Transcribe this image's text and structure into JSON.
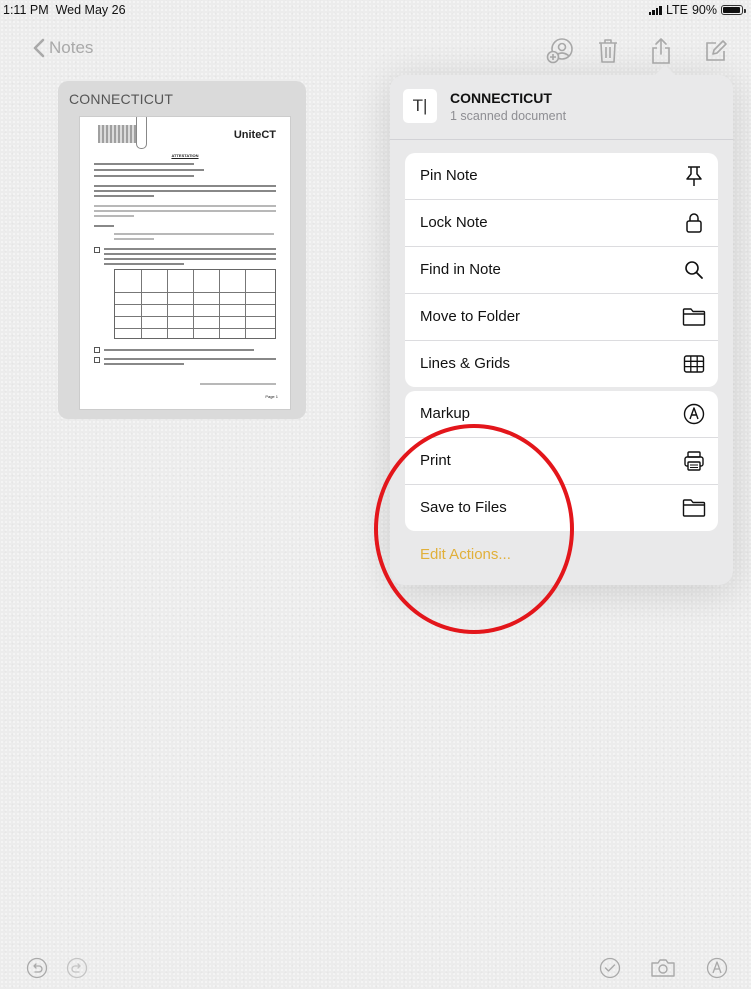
{
  "status_bar": {
    "time": "1:11 PM",
    "date": "Wed May 26",
    "network": "LTE",
    "battery": "90%"
  },
  "nav": {
    "back_label": "Notes"
  },
  "note_card": {
    "title": "CONNECTICUT",
    "document": {
      "logo": "UniteCT",
      "heading": "ATTESTATION",
      "page_label": "Page 1"
    }
  },
  "popover": {
    "header": {
      "title": "CONNECTICUT",
      "subtitle": "1 scanned document",
      "thumb_glyph": "T|"
    },
    "group1": [
      {
        "label": "Pin Note",
        "icon": "pin-icon"
      },
      {
        "label": "Lock Note",
        "icon": "lock-icon"
      },
      {
        "label": "Find in Note",
        "icon": "magnifier-icon"
      },
      {
        "label": "Move to Folder",
        "icon": "folder-icon"
      },
      {
        "label": "Lines & Grids",
        "icon": "grid-icon"
      }
    ],
    "group2": [
      {
        "label": "Markup",
        "icon": "markup-pen-icon"
      },
      {
        "label": "Print",
        "icon": "printer-icon"
      },
      {
        "label": "Save to Files",
        "icon": "folder-icon"
      }
    ],
    "edit_actions_label": "Edit Actions..."
  },
  "annotation": {
    "color": "#e3161b",
    "shape": "red-circle"
  },
  "colors": {
    "accent": "#e1b03a",
    "inactive": "#a9a9a9"
  }
}
